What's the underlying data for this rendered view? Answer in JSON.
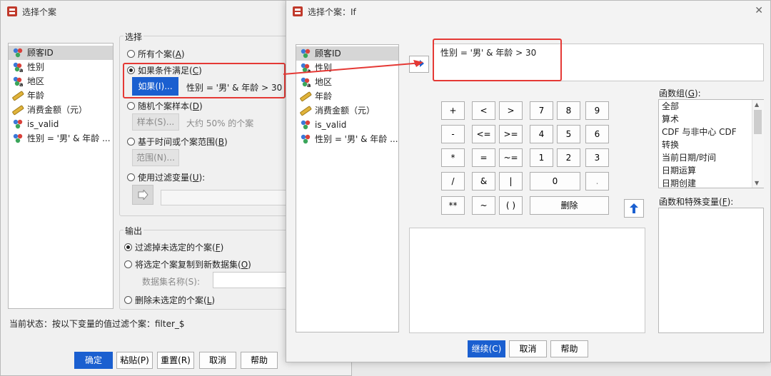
{
  "colors": {
    "accent": "#1a5fd0",
    "highlight": "#e53935"
  },
  "main_dialog": {
    "title": "选择个案",
    "variables": [
      {
        "label": "顾客ID",
        "icon": "nominal-icon"
      },
      {
        "label": "性别",
        "icon": "nominal-string-icon"
      },
      {
        "label": "地区",
        "icon": "nominal-string-icon"
      },
      {
        "label": "年龄",
        "icon": "scale-icon"
      },
      {
        "label": "消费金额（元）",
        "icon": "scale-icon"
      },
      {
        "label": "is_valid",
        "icon": "nominal-icon"
      },
      {
        "label": "性别 = '男' & 年龄 ...",
        "icon": "nominal-icon"
      }
    ],
    "select_group_label": "选择",
    "opt_all": "所有个案",
    "opt_all_key": "A",
    "opt_if": "如果条件满足",
    "opt_if_key": "C",
    "if_button": "如果(I)...",
    "if_condition": "性别 = '男' & 年龄 > 30",
    "opt_random": "随机个案样本",
    "opt_random_key": "D",
    "sample_button": "样本(S)...",
    "sample_text": "大约 50% 的个案",
    "opt_range": "基于时间或个案范围",
    "opt_range_key": "B",
    "range_button": "范围(N)...",
    "opt_filter": "使用过滤变量",
    "opt_filter_key": "U",
    "output_group_label": "输出",
    "out_filter": "过滤掉未选定的个案",
    "out_filter_key": "F",
    "out_copy": "将选定个案复制到新数据集",
    "out_copy_key": "O",
    "dataset_label": "数据集名称(S):",
    "out_delete": "删除未选定的个案",
    "out_delete_key": "L",
    "status": "当前状态：按以下变量的值过滤个案：filter_$",
    "buttons": {
      "ok": "确定",
      "paste": "粘贴(P)",
      "reset": "重置(R)",
      "cancel": "取消",
      "help": "帮助"
    }
  },
  "if_dialog": {
    "title": "选择个案：If",
    "variables": [
      {
        "label": "顾客ID",
        "icon": "nominal-icon"
      },
      {
        "label": "性别",
        "icon": "nominal-string-icon"
      },
      {
        "label": "地区",
        "icon": "nominal-string-icon"
      },
      {
        "label": "年龄",
        "icon": "scale-icon"
      },
      {
        "label": "消费金额（元）",
        "icon": "scale-icon"
      },
      {
        "label": "is_valid",
        "icon": "nominal-icon"
      },
      {
        "label": "性别 = '男' & 年龄 ...",
        "icon": "nominal-icon"
      }
    ],
    "expression": "性别 = '男' & 年龄 > 30",
    "keypad": [
      [
        "+",
        "<",
        ">",
        "7",
        "8",
        "9"
      ],
      [
        "-",
        "<=",
        ">=",
        "4",
        "5",
        "6"
      ],
      [
        "*",
        "=",
        "~=",
        "1",
        "2",
        "3"
      ],
      [
        "/",
        "&",
        "|",
        "0",
        "."
      ],
      [
        "**",
        "~",
        "( )",
        "删除"
      ]
    ],
    "function_group_label": "函数组(G):",
    "function_groups": [
      "全部",
      "算术",
      "CDF 与非中心 CDF",
      "转换",
      "当前日期/时间",
      "日期运算",
      "日期创建"
    ],
    "functions_label": "函数和特殊变量(F):",
    "buttons": {
      "continue": "继续(C)",
      "cancel": "取消",
      "help": "帮助"
    }
  }
}
